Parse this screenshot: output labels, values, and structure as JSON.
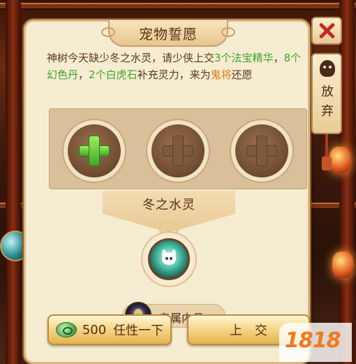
{
  "dialog": {
    "title": "宠物誓愿",
    "description": {
      "p1": "神树今天缺少冬之水灵，请少侠上交",
      "p2": "3个法宝精华",
      "p3": "，",
      "p4": "8个幻色丹",
      "p5": "，",
      "p6": "2个白虎石",
      "p7": "补充灵力，来为",
      "p8": "鬼将",
      "p9": "还愿"
    },
    "slots": [
      {
        "state": "add"
      },
      {
        "state": "empty"
      },
      {
        "state": "empty"
      }
    ],
    "target_name": "冬之水灵",
    "reward": {
      "label": "专属内丹"
    },
    "buttons": {
      "left_cost": "500",
      "left_label": "任性一下",
      "right_label": "上交"
    }
  },
  "side": {
    "close_label": "",
    "giveup_label": "放弃"
  },
  "watermark": {
    "text": "1818"
  },
  "colors": {
    "panel_bg": "#f6ecd2",
    "highlight_green": "#3da52c",
    "highlight_orange": "#e27812",
    "close_red": "#c82a1e"
  },
  "icons": {
    "close": "close-icon",
    "giveup": "emote-face-icon",
    "add": "plus-icon",
    "coin": "jade-coin-icon",
    "reward": "water-spirit-icon",
    "dan": "core-pill-icon"
  }
}
